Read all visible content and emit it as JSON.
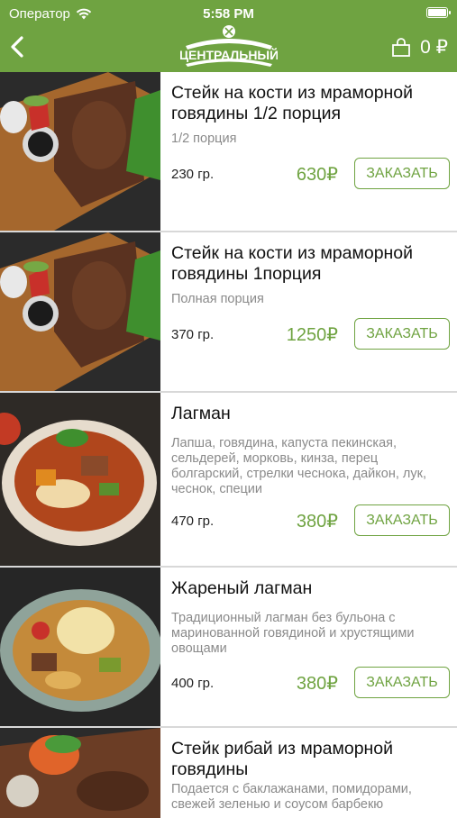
{
  "status": {
    "carrier": "Оператор",
    "time": "5:58 PM"
  },
  "header": {
    "logo_text": "ЦЕНТРАЛЬНЫЙ",
    "cart_total": "0 ₽"
  },
  "items": [
    {
      "name": "Стейк на кости из мраморной говядины 1/2 порция",
      "desc": "1/2 порция",
      "weight": "230 гр.",
      "price": "630₽",
      "button": "ЗАКАЗАТЬ"
    },
    {
      "name": "Стейк на кости из мраморной говядины 1порция",
      "desc": "Полная порция",
      "weight": "370 гр.",
      "price": "1250₽",
      "button": "ЗАКАЗАТЬ"
    },
    {
      "name": "Лагман",
      "desc": "Лапша, говядина, капуста пекинская, сельдерей, морковь, кинза, перец болгарский, стрелки чеснока, дайкон, лук, чеснок, специи",
      "weight": "470 гр.",
      "price": "380₽",
      "button": "ЗАКАЗАТЬ"
    },
    {
      "name": "Жареный лагман",
      "desc": "Традиционный лагман без бульона с маринованной говядиной и хрустящими овощами",
      "weight": "400 гр.",
      "price": "380₽",
      "button": "ЗАКАЗАТЬ"
    },
    {
      "name": "Стейк рибай из мраморной говядины",
      "desc": "Подается с баклажанами, помидорами, свежей зеленью и соусом барбекю",
      "weight": "",
      "price": "",
      "button": ""
    }
  ]
}
